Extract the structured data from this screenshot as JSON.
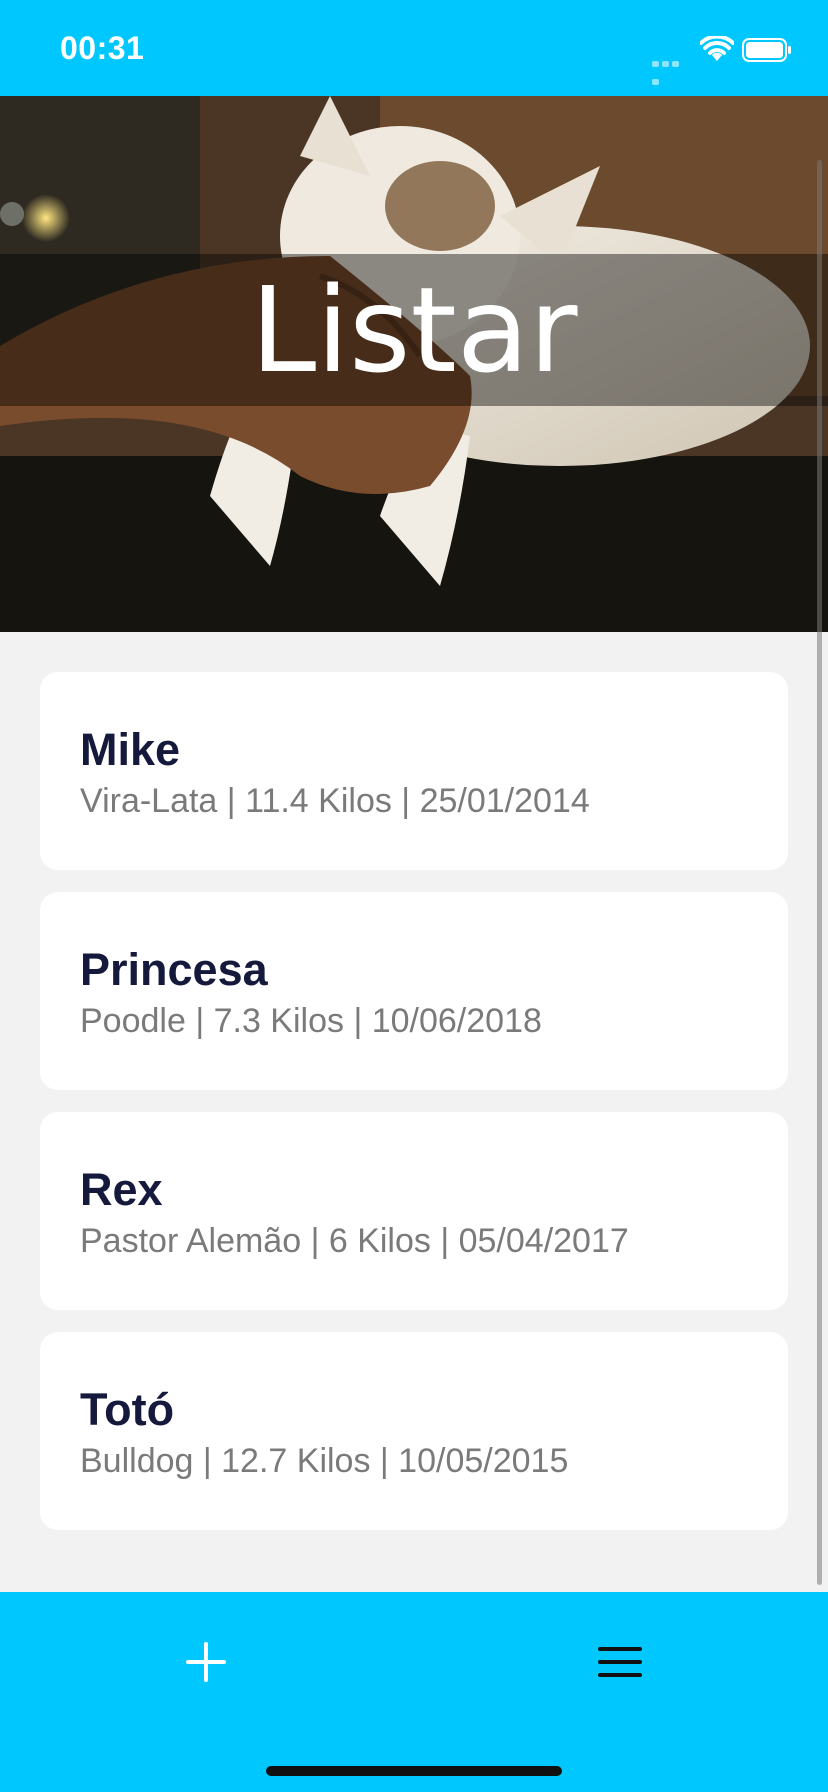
{
  "status_bar": {
    "time": "00:31",
    "icons": [
      "signal-icon",
      "wifi-icon",
      "battery-icon"
    ]
  },
  "header": {
    "title": "Listar",
    "image": "cat-photo"
  },
  "pets": [
    {
      "name": "Mike",
      "info": "Vira-Lata | 11.4 Kilos | 25/01/2014"
    },
    {
      "name": "Princesa",
      "info": "Poodle | 7.3 Kilos | 10/06/2018"
    },
    {
      "name": "Rex",
      "info": "Pastor Alemão | 6 Kilos | 05/04/2017"
    },
    {
      "name": "Totó",
      "info": "Bulldog | 12.7 Kilos | 10/05/2015"
    }
  ],
  "tab_bar": {
    "add_icon": "plus-icon",
    "menu_icon": "hamburger-menu-icon"
  },
  "colors": {
    "accent": "#00c8ff",
    "card_background": "#ffffff",
    "page_background": "#f2f2f2",
    "name_text": "#151a3c",
    "info_text": "#7a7a7a"
  }
}
